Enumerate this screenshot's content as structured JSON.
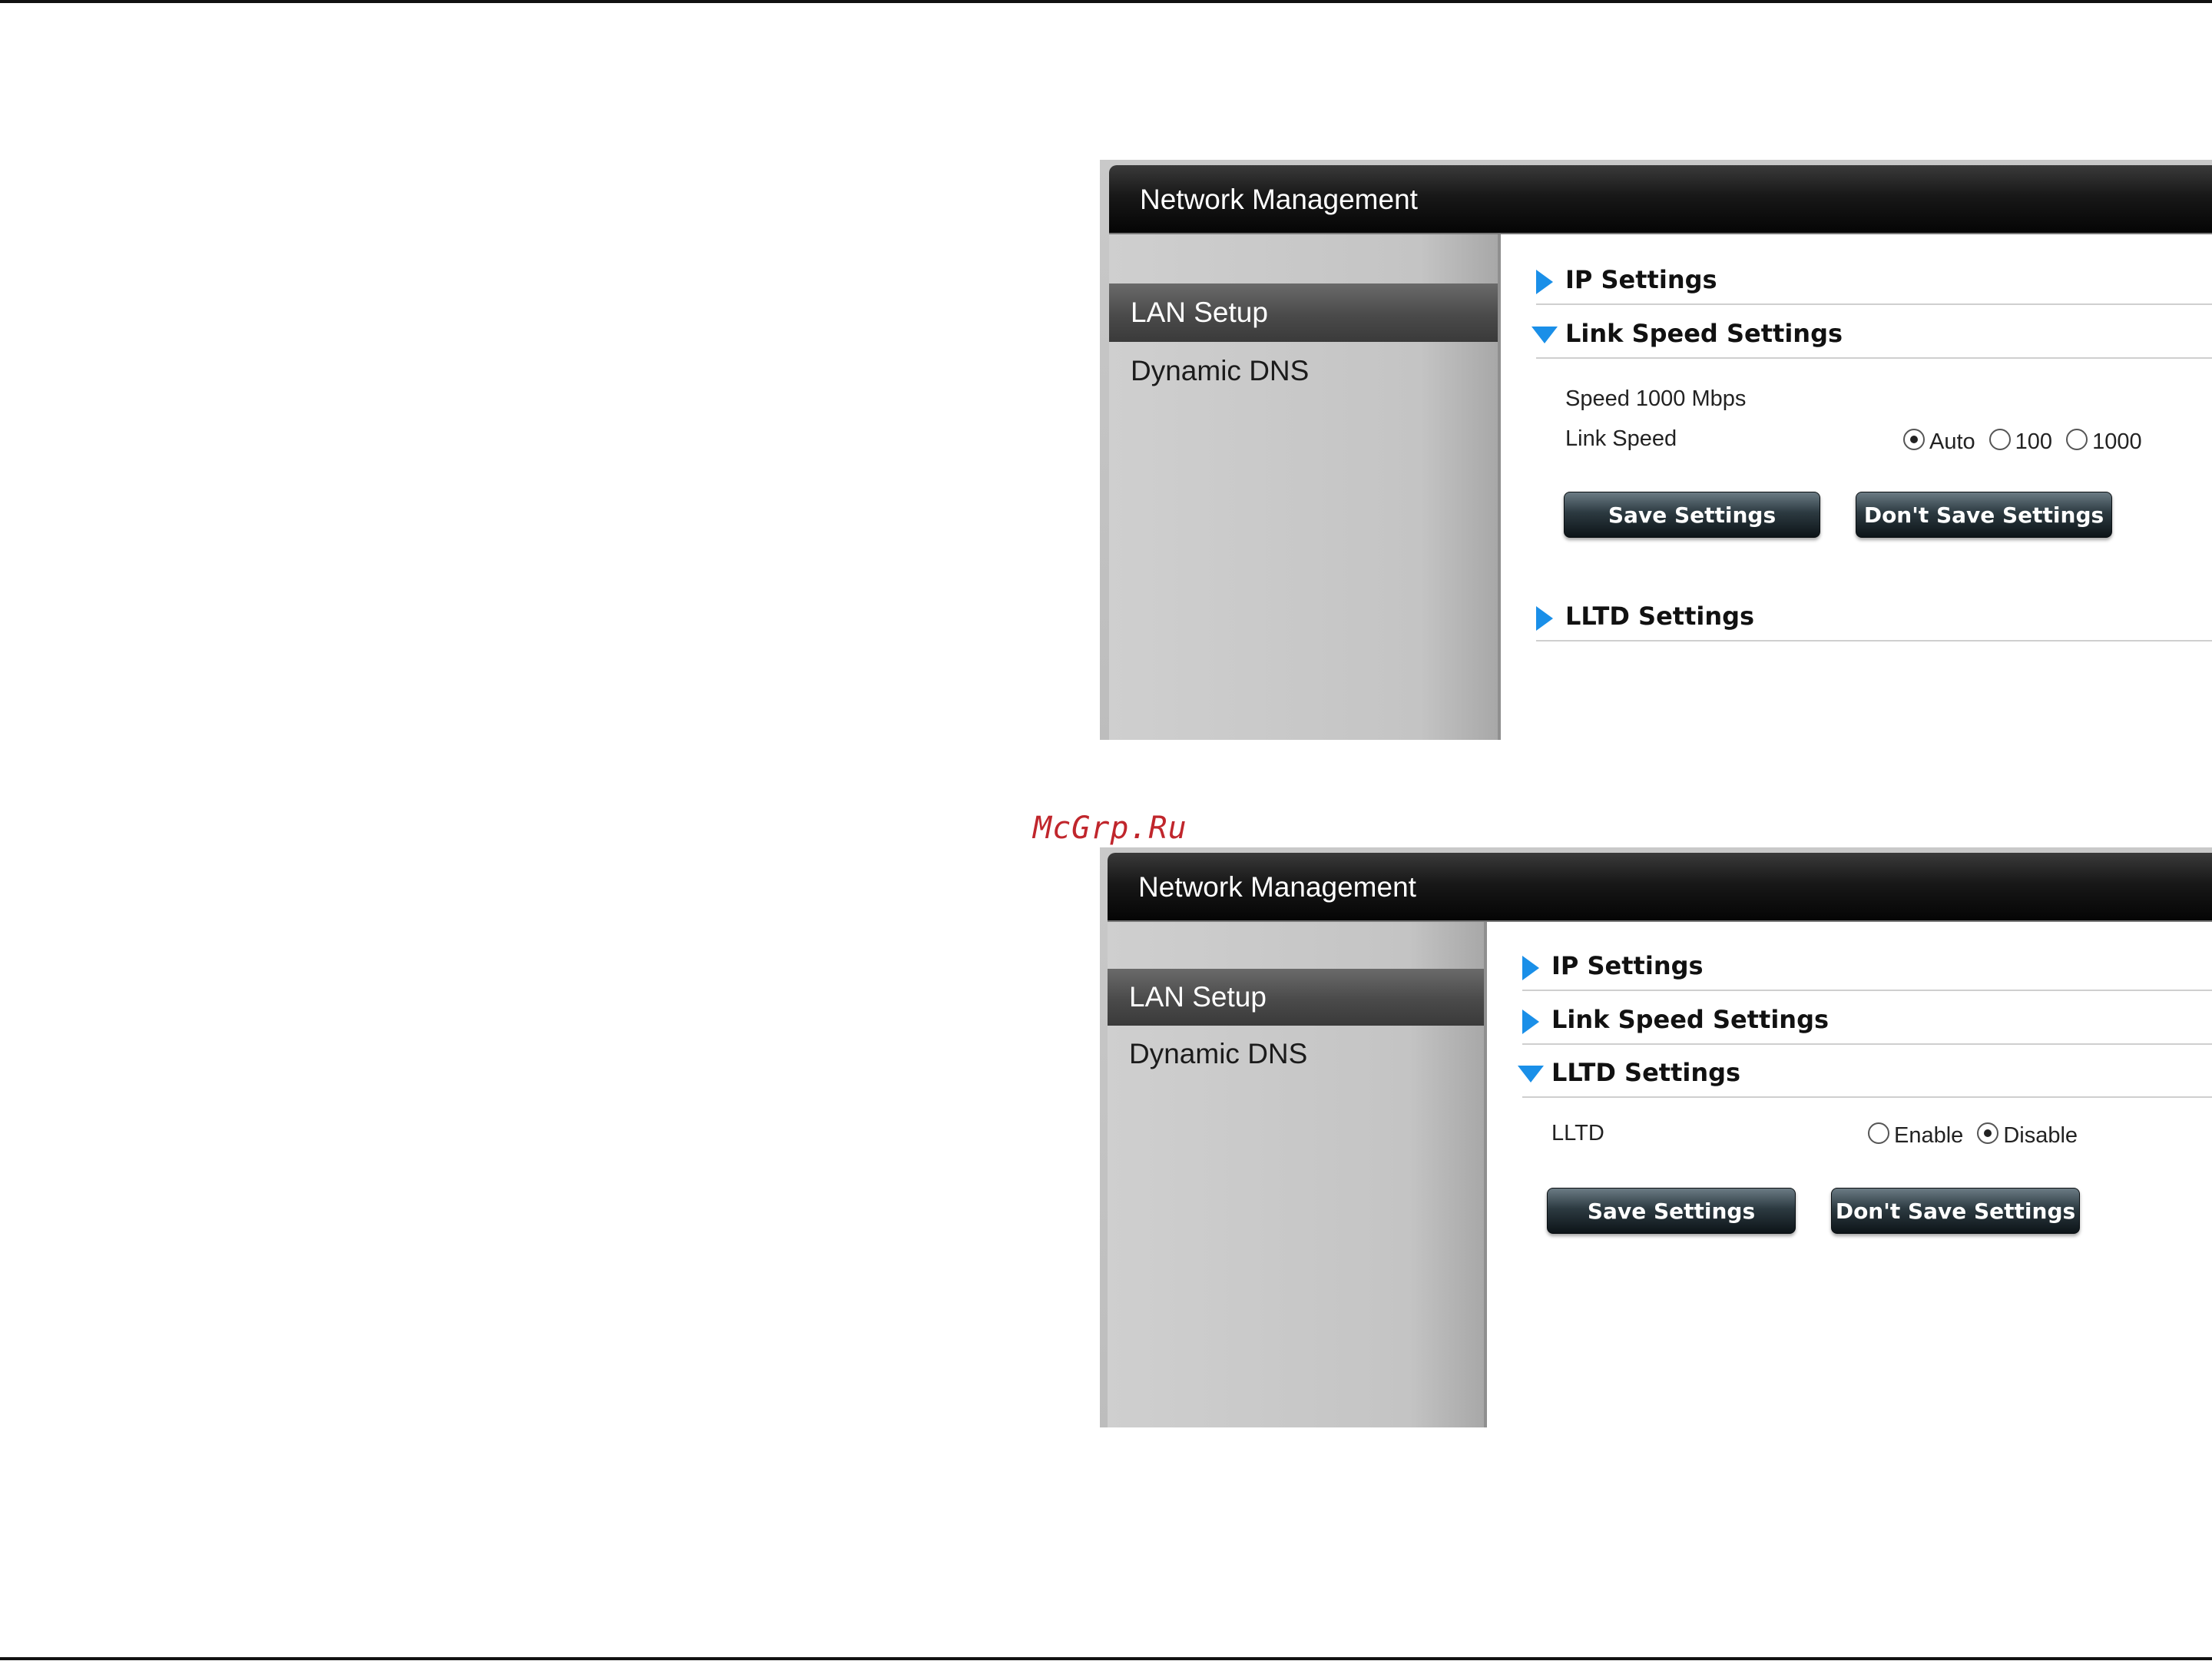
{
  "watermark": "McGrp.Ru",
  "panel1": {
    "title": "Network Management",
    "nav": [
      "LAN Setup",
      "Dynamic DNS"
    ],
    "sections": {
      "ip": "IP Settings",
      "link": "Link Speed Settings",
      "lltd": "LLTD Settings"
    },
    "speed_text": "Speed 1000 Mbps",
    "link_speed_label": "Link Speed",
    "link_options": [
      "Auto",
      "100",
      "1000"
    ],
    "link_selected": "Auto",
    "save_label": "Save Settings",
    "dont_save_label": "Don't Save Settings"
  },
  "panel2": {
    "title": "Network Management",
    "nav": [
      "LAN Setup",
      "Dynamic DNS"
    ],
    "sections": {
      "ip": "IP Settings",
      "link": "Link Speed Settings",
      "lltd": "LLTD Settings"
    },
    "lltd_label": "LLTD",
    "lltd_options": [
      "Enable",
      "Disable"
    ],
    "lltd_selected": "Disable",
    "save_label": "Save Settings",
    "dont_save_label": "Don't Save Settings"
  },
  "colors": {
    "accent_triangle": "#1a8fe8",
    "watermark": "#c0262c"
  }
}
